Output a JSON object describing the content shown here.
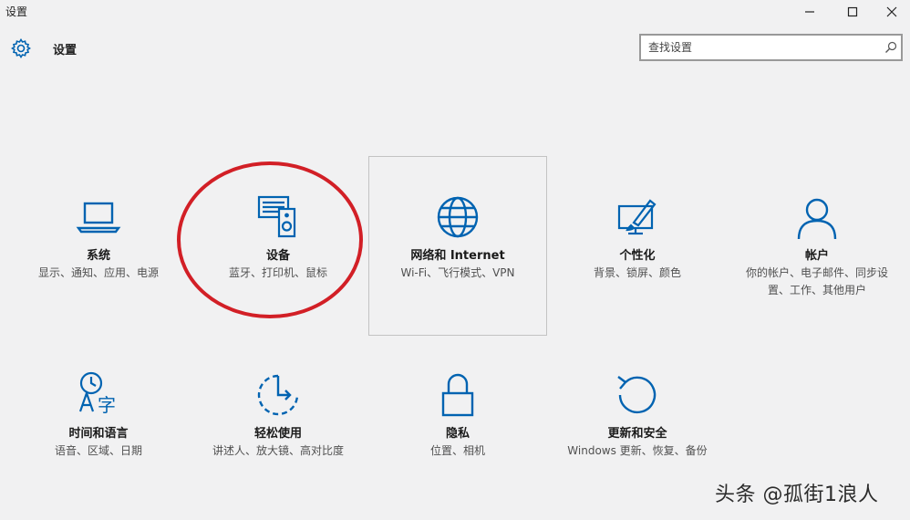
{
  "window": {
    "title": "设置"
  },
  "header": {
    "title": "设置"
  },
  "search": {
    "placeholder": "查找设置"
  },
  "categories": [
    {
      "name": "系统",
      "desc": "显示、通知、应用、电源",
      "icon": "laptop-icon"
    },
    {
      "name": "设备",
      "desc": "蓝牙、打印机、鼠标",
      "icon": "devices-icon"
    },
    {
      "name": "网络和 Internet",
      "desc": "Wi-Fi、飞行模式、VPN",
      "icon": "globe-icon"
    },
    {
      "name": "个性化",
      "desc": "背景、锁屏、颜色",
      "icon": "personalization-icon"
    },
    {
      "name": "帐户",
      "desc": "你的帐户、电子邮件、同步设置、工作、其他用户",
      "icon": "person-icon"
    },
    {
      "name": "时间和语言",
      "desc": "语音、区域、日期",
      "icon": "time-language-icon"
    },
    {
      "name": "轻松使用",
      "desc": "讲述人、放大镜、高对比度",
      "icon": "ease-of-access-icon"
    },
    {
      "name": "隐私",
      "desc": "位置、相机",
      "icon": "lock-icon"
    },
    {
      "name": "更新和安全",
      "desc": "Windows 更新、恢复、备份",
      "icon": "update-icon"
    }
  ],
  "watermark": "头条 @孤街1浪人",
  "colors": {
    "accent": "#0063b1",
    "annotation": "#d21f26",
    "background": "#f1f1f2"
  }
}
